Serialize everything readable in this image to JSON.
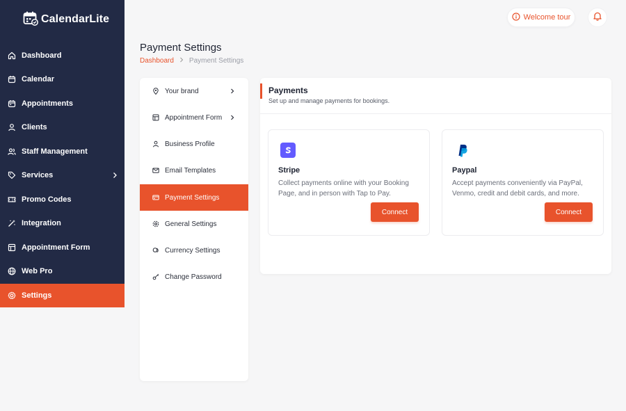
{
  "app": {
    "name": "CalendarLite"
  },
  "sidebar": {
    "items": [
      {
        "label": "Dashboard",
        "icon": "home-icon"
      },
      {
        "label": "Calendar",
        "icon": "calendar-icon"
      },
      {
        "label": "Appointments",
        "icon": "calendar-check-icon"
      },
      {
        "label": "Clients",
        "icon": "user-icon"
      },
      {
        "label": "Staff Management",
        "icon": "users-icon"
      },
      {
        "label": "Services",
        "icon": "tag-icon",
        "has_submenu": true
      },
      {
        "label": "Promo Codes",
        "icon": "ticket-icon"
      },
      {
        "label": "Integration",
        "icon": "magic-wand-icon"
      },
      {
        "label": "Appointment Form",
        "icon": "form-icon"
      },
      {
        "label": "Web Pro",
        "icon": "globe-icon"
      },
      {
        "label": "Settings",
        "icon": "gear-icon",
        "active": true
      }
    ]
  },
  "header": {
    "welcome_tour_label": "Welcome tour"
  },
  "page": {
    "title": "Payment Settings",
    "breadcrumb": {
      "link": "Dashboard",
      "current": "Payment Settings"
    }
  },
  "settings_menu": {
    "items": [
      {
        "label": "Your brand",
        "icon": "pin-icon",
        "has_submenu": true
      },
      {
        "label": "Appointment Form",
        "icon": "form-icon",
        "has_submenu": true
      },
      {
        "label": "Business Profile",
        "icon": "user-icon"
      },
      {
        "label": "Email Templates",
        "icon": "mail-icon"
      },
      {
        "label": "Payment Settings",
        "icon": "card-icon",
        "active": true
      },
      {
        "label": "General Settings",
        "icon": "gear-icon"
      },
      {
        "label": "Currency Settings",
        "icon": "coins-icon"
      },
      {
        "label": "Change Password",
        "icon": "key-icon"
      }
    ]
  },
  "payments": {
    "title": "Payments",
    "subtitle": "Set up and manage payments for bookings.",
    "providers": [
      {
        "name": "Stripe",
        "icon": "stripe-logo-icon",
        "description": "Collect payments online with your Booking Page, and in person with Tap to Pay.",
        "button_label": "Connect"
      },
      {
        "name": "Paypal",
        "icon": "paypal-logo-icon",
        "description": "Accept payments conveniently via PayPal, Venmo, credit and debit cards, and more.",
        "button_label": "Connect"
      }
    ]
  },
  "colors": {
    "accent": "#e8532c",
    "sidebar_bg": "#222a45",
    "stripe": "#635bff",
    "paypal_dark": "#003087",
    "paypal_light": "#009cde"
  }
}
